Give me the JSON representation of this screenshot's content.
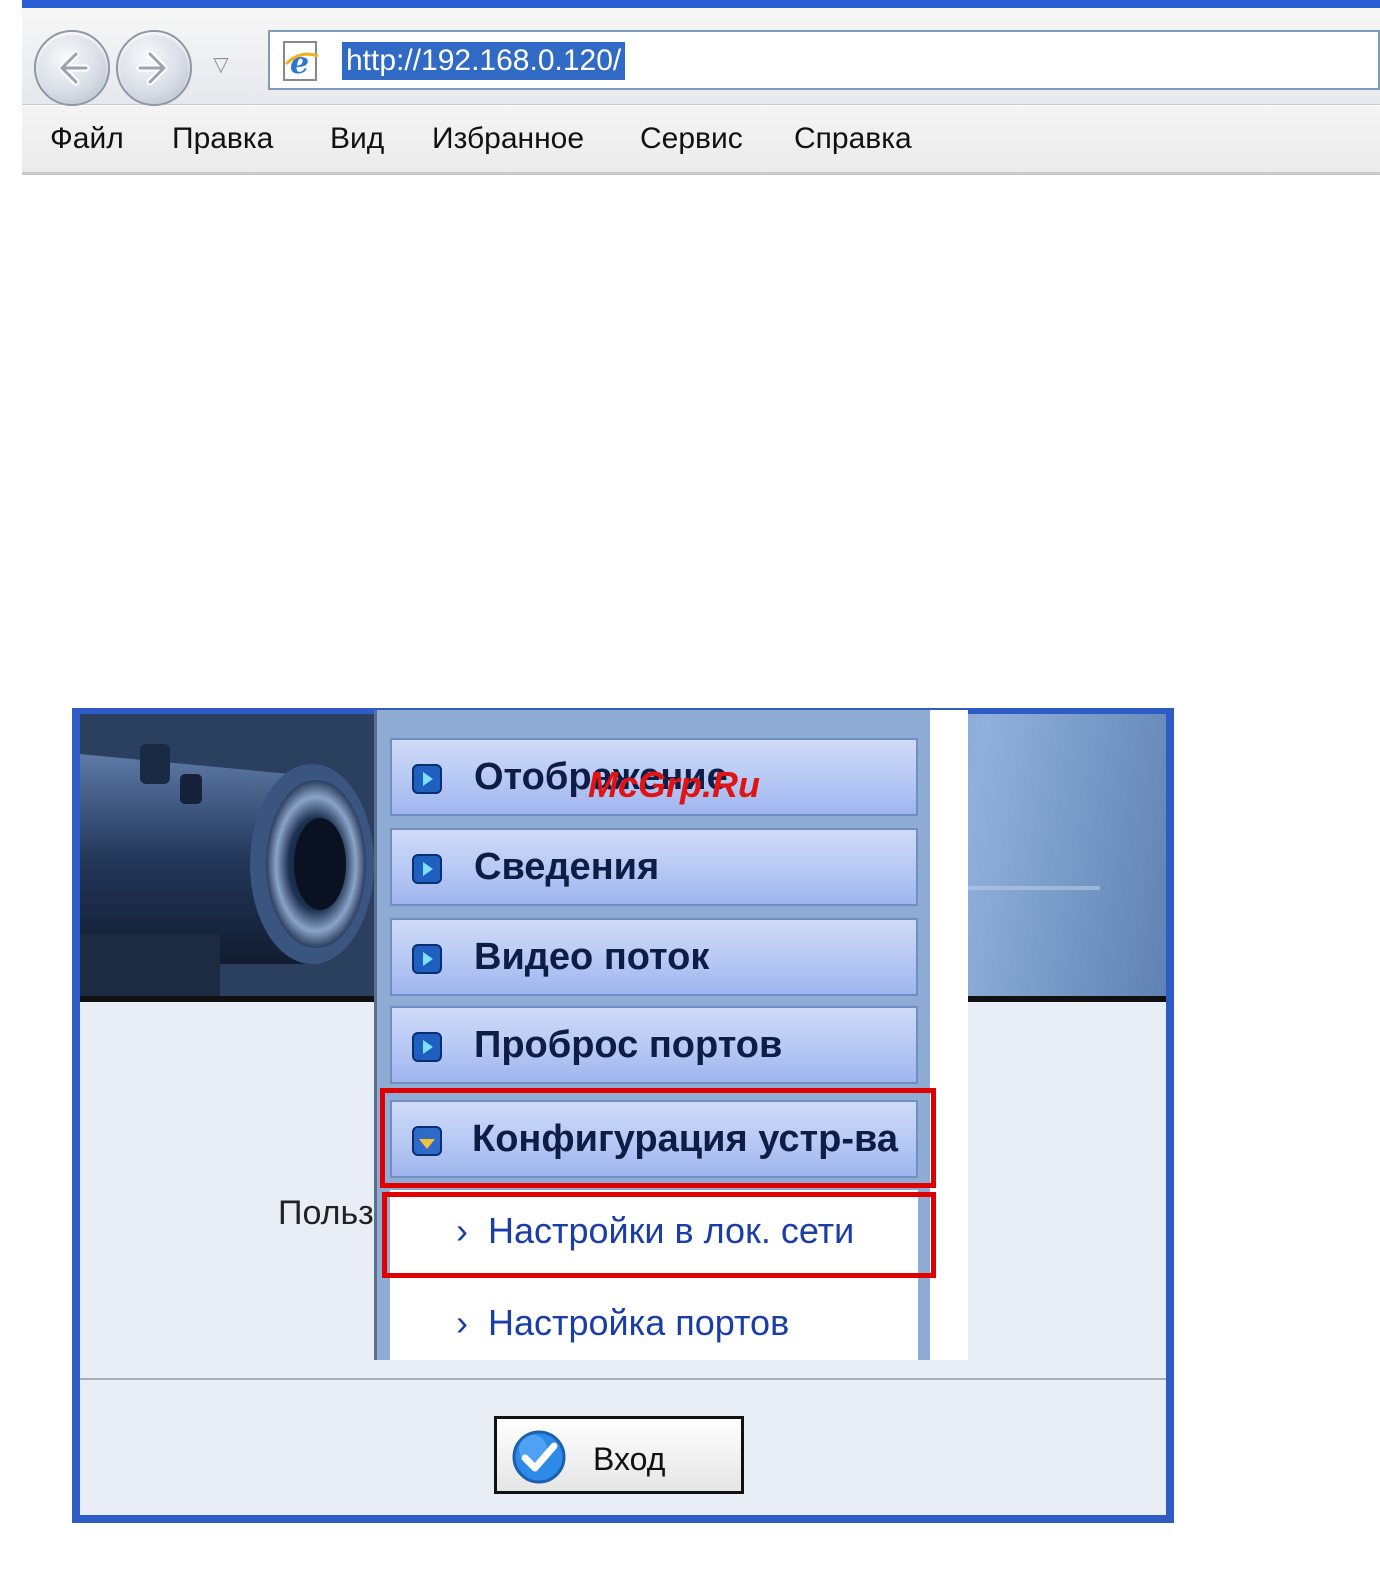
{
  "browser": {
    "url": "http://192.168.0.120/",
    "menu": [
      "Файл",
      "Правка",
      "Вид",
      "Избранное",
      "Сервис",
      "Справка"
    ],
    "icons": [
      "back-icon",
      "forward-icon",
      "dropdown-icon",
      "ie-page-icon"
    ]
  },
  "login_page": {
    "user_label": "Польз",
    "login_button": "Вход"
  },
  "side_menu": {
    "items": [
      {
        "label": "Отображение",
        "icon": "play-icon"
      },
      {
        "label": "Сведения",
        "icon": "play-icon"
      },
      {
        "label": "Видео поток",
        "icon": "play-icon"
      },
      {
        "label": "Проброс портов",
        "icon": "play-icon"
      },
      {
        "label": "Конфигурация устр-ва",
        "icon": "expanded-icon",
        "highlighted": true
      }
    ],
    "subitems": [
      {
        "label": "Настройки в лок. сети",
        "highlighted": true
      },
      {
        "label": "Настройка портов"
      }
    ]
  },
  "watermark": "McGrp.Ru",
  "colors": {
    "highlight": "#e00000",
    "url_selection": "#316ac5",
    "page_border": "#2f5bc4",
    "submenu_text": "#1a3ea8"
  }
}
